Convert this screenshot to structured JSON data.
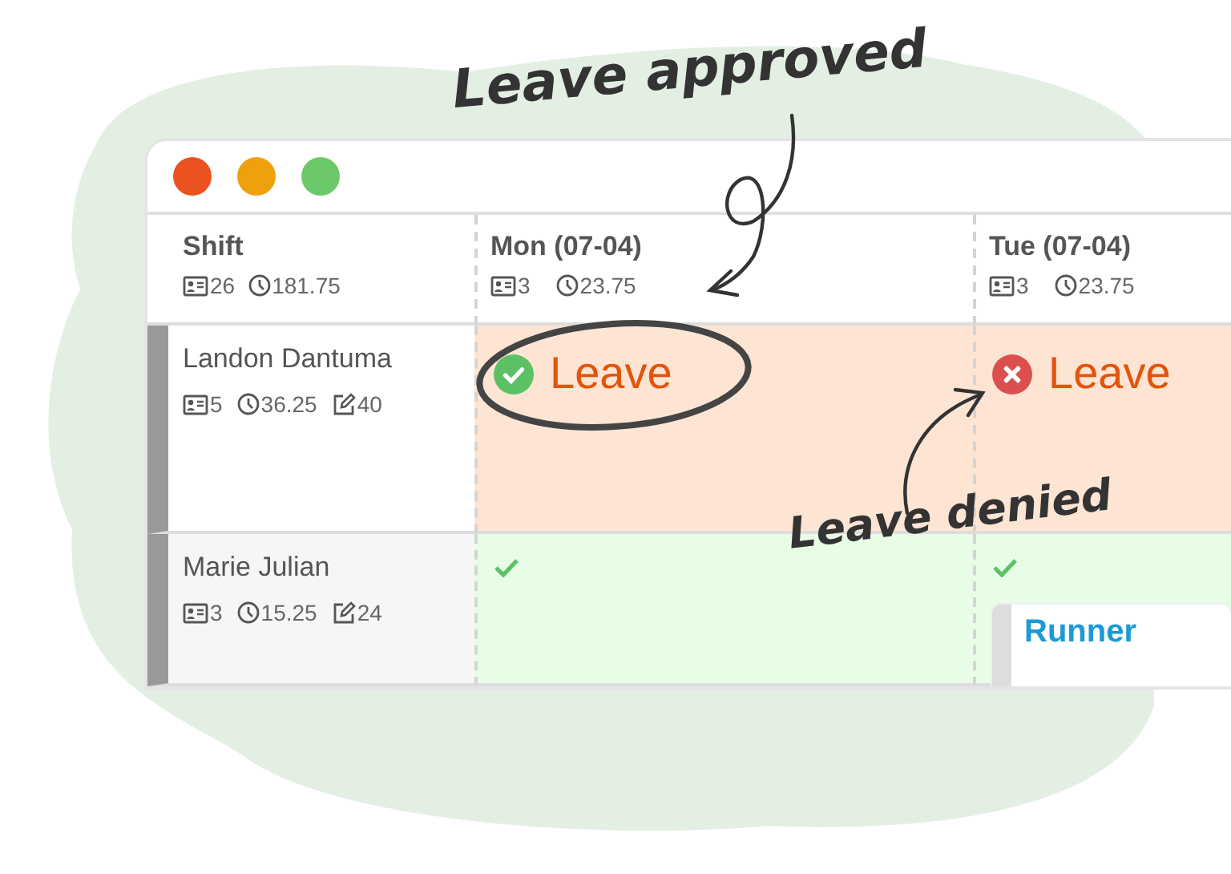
{
  "annotations": [
    {
      "kind": "approved",
      "text": "Leave approved"
    },
    {
      "kind": "denied",
      "text": "Leave denied"
    }
  ],
  "header": {
    "title": "Shift",
    "staff_count": "26",
    "hours": "181.75"
  },
  "days": [
    {
      "label": "Mon (07-04)",
      "staff_count": "3",
      "hours": "23.75"
    },
    {
      "label": "Tue (07-04)",
      "staff_count": "3",
      "hours": "23.75"
    }
  ],
  "employees": [
    {
      "name": "Landon Dantuma",
      "shifts": "5",
      "hours": "36.25",
      "edits": "40",
      "cells": [
        {
          "kind": "leave",
          "approved": true,
          "text": "Leave"
        },
        {
          "kind": "leave",
          "approved": false,
          "text": "Leave"
        }
      ]
    },
    {
      "name": "Marie Julian",
      "shifts": "3",
      "hours": "15.25",
      "edits": "24",
      "cells": [
        {
          "kind": "available"
        },
        {
          "kind": "available",
          "shift": {
            "title": "Runner"
          }
        }
      ]
    }
  ]
}
